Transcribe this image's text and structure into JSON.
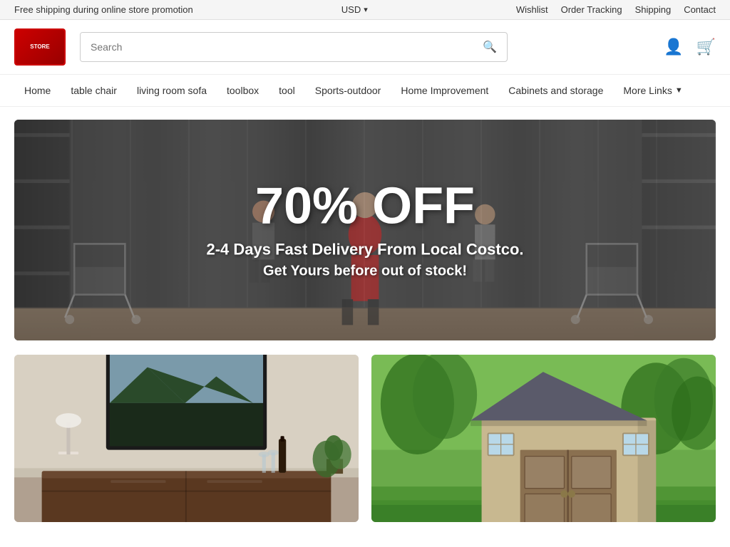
{
  "topbar": {
    "promo_text": "Free shipping during online store promotion",
    "currency": "USD",
    "currency_arrow": "▾",
    "links": [
      "Wishlist",
      "Order Tracking",
      "Shipping",
      "Contact"
    ]
  },
  "header": {
    "search_placeholder": "Search",
    "logo_alt": "Store Logo"
  },
  "nav": {
    "items": [
      {
        "label": "Home",
        "id": "home"
      },
      {
        "label": "table chair",
        "id": "table-chair"
      },
      {
        "label": "living room sofa",
        "id": "living-room-sofa"
      },
      {
        "label": "toolbox",
        "id": "toolbox"
      },
      {
        "label": "tool",
        "id": "tool"
      },
      {
        "label": "Sports-outdoor",
        "id": "sports-outdoor"
      },
      {
        "label": "Home Improvement",
        "id": "home-improvement"
      },
      {
        "label": "Cabinets and storage",
        "id": "cabinets-storage"
      }
    ],
    "more_label": "More Links"
  },
  "hero": {
    "discount": "70% OFF",
    "delivery": "2-4 Days Fast Delivery From Local Costco.",
    "cta": "Get Yours before out of stock!"
  },
  "products": {
    "card1_alt": "Living room furniture",
    "card2_alt": "Outdoor shed"
  }
}
